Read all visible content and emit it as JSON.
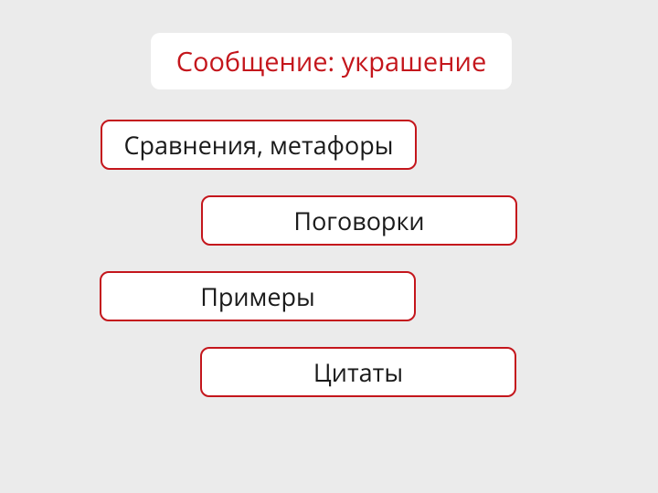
{
  "header": {
    "title": "Сообщение: украшение"
  },
  "items": [
    {
      "label": "Сравнения, метафоры"
    },
    {
      "label": "Поговорки"
    },
    {
      "label": "Примеры"
    },
    {
      "label": "Цитаты"
    }
  ],
  "colors": {
    "accent": "#c4161c",
    "background": "#ebebeb",
    "pill_bg": "#ffffff"
  }
}
